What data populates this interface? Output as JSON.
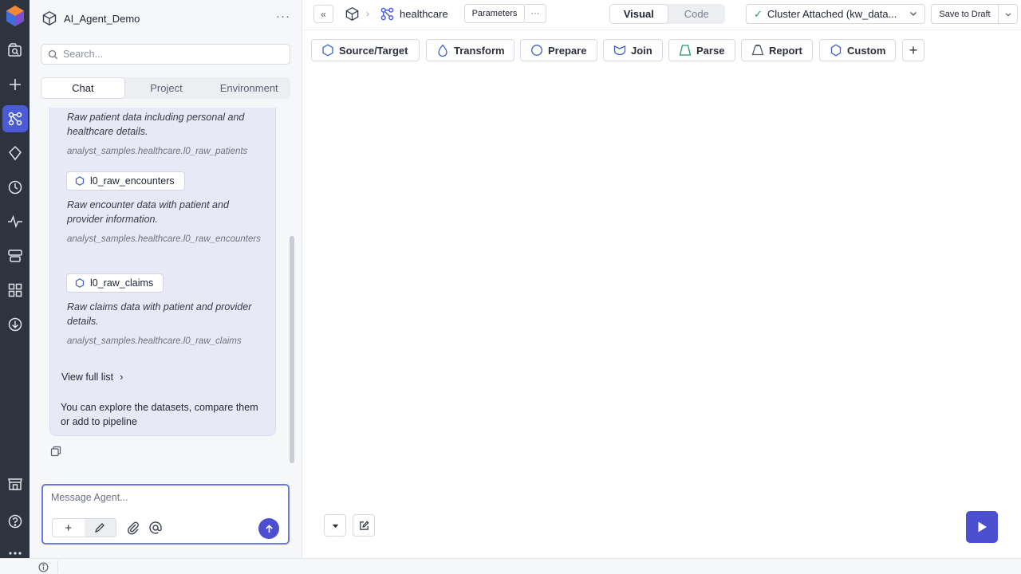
{
  "project": {
    "name": "AI_Agent_Demo",
    "more": "···"
  },
  "search": {
    "placeholder": "Search..."
  },
  "panel_tabs": [
    {
      "label": "Chat",
      "active": true
    },
    {
      "label": "Project",
      "active": false
    },
    {
      "label": "Environment",
      "active": false
    }
  ],
  "chat": {
    "datasets": [
      {
        "name": "",
        "desc": "Raw patient data including personal and healthcare details.",
        "path": "analyst_samples.healthcare.l0_raw_patients"
      },
      {
        "name": "l0_raw_encounters",
        "desc": "Raw encounter data with patient and provider information.",
        "path": "analyst_samples.healthcare.l0_raw_encounters"
      },
      {
        "name": "l0_raw_claims",
        "desc": "Raw claims data with patient and provider details.",
        "path": "analyst_samples.healthcare.l0_raw_claims"
      }
    ],
    "view_full": "View full list",
    "view_full_chevron": "›",
    "tail": "You can explore the datasets, compare them or add to pipeline"
  },
  "composer": {
    "placeholder": "Message Agent...",
    "plus": "+"
  },
  "topbar": {
    "collapse": "«",
    "sep": "›",
    "pipeline": "healthcare",
    "params": "Parameters",
    "params_more": "···",
    "view_tabs": [
      {
        "label": "Visual",
        "active": true
      },
      {
        "label": "Code",
        "active": false
      }
    ],
    "cluster_check": "✓",
    "cluster": "Cluster Attached (kw_data...",
    "save": "Save to Draft"
  },
  "gems": [
    {
      "label": "Source/Target",
      "icon": "hexagon-icon",
      "color": "#3b5fc4"
    },
    {
      "label": "Transform",
      "icon": "drop-icon",
      "color": "#3b5fc4"
    },
    {
      "label": "Prepare",
      "icon": "circle-icon",
      "color": "#3b5fc4"
    },
    {
      "label": "Join",
      "icon": "join-icon",
      "color": "#3b5fc4"
    },
    {
      "label": "Parse",
      "icon": "trapezoid-icon",
      "color": "#1f9a6a"
    },
    {
      "label": "Report",
      "icon": "report-icon",
      "color": "#555b68"
    },
    {
      "label": "Custom",
      "icon": "hexagon-icon",
      "color": "#3b5fc4"
    }
  ],
  "add_gem": "+",
  "colors": {
    "accent": "#4b4fd0",
    "rail": "#2d3440",
    "rail_active": "#4b5bd6"
  }
}
